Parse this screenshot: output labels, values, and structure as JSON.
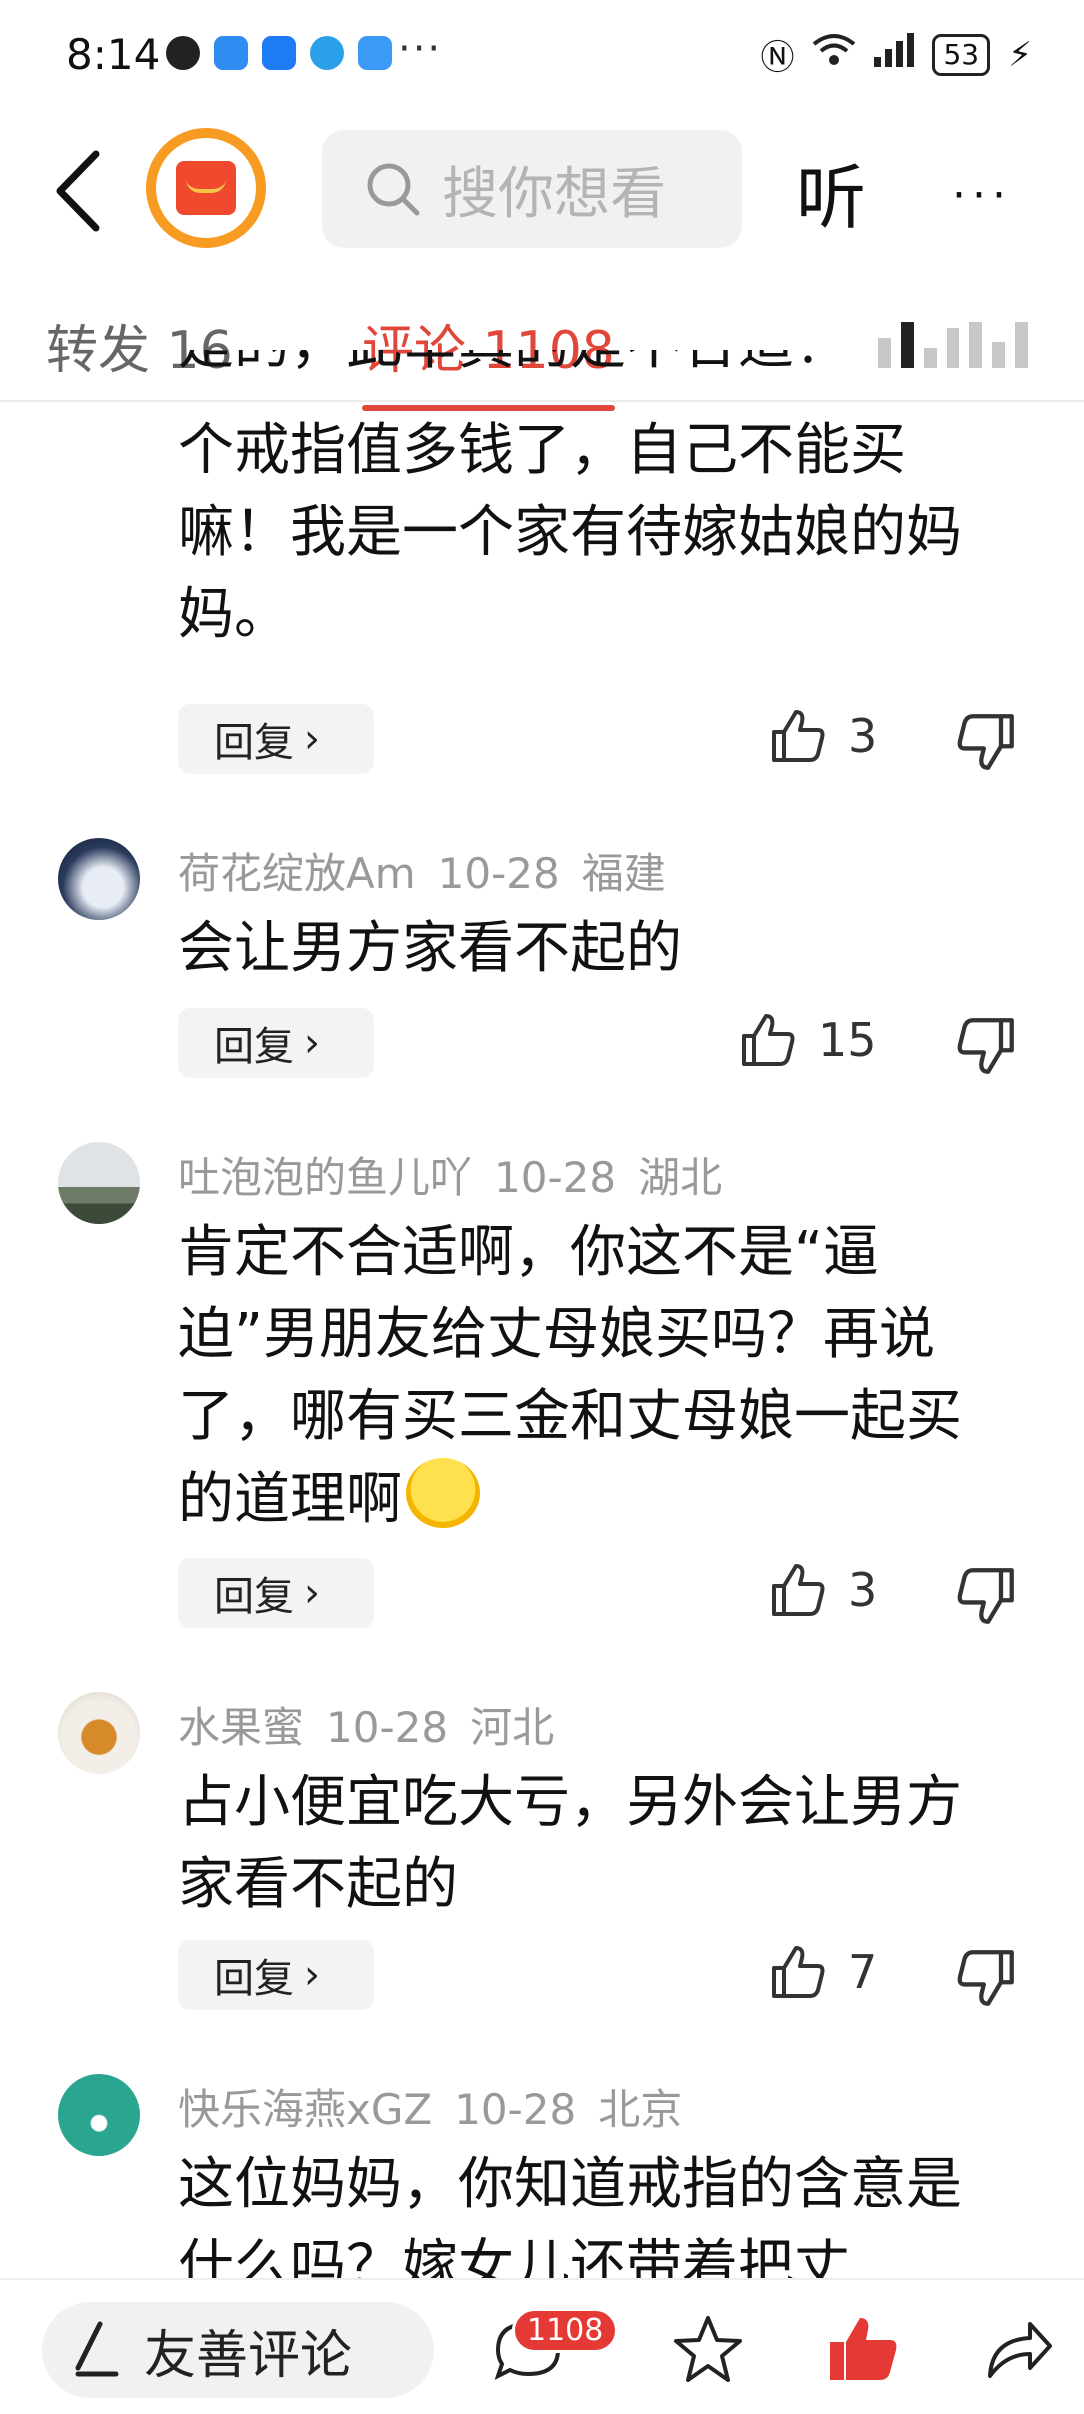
{
  "status_bar": {
    "time": "8:14",
    "more": "···",
    "battery": "53"
  },
  "search": {
    "placeholder": "搜你想看"
  },
  "header": {
    "listen": "听",
    "more": "···"
  },
  "tabs": [
    {
      "label": "转发 16",
      "active": false
    },
    {
      "label": "评论 1108",
      "active": true
    }
  ],
  "comments": [
    {
      "partial_first_line": "是的，此举真的是不合适！一",
      "text": "个戒指值多钱了，自己不能买嘛！我是一个家有待嫁姑娘的妈妈。",
      "reply": "回复",
      "likes": "3"
    },
    {
      "user": "荷花绽放Am",
      "date": "10-28",
      "location": "福建",
      "text": "会让男方家看不起的",
      "reply": "回复",
      "likes": "15"
    },
    {
      "user": "吐泡泡的鱼儿吖",
      "date": "10-28",
      "location": "湖北",
      "text": "肯定不合适啊，你这不是“逼迫”男朋友给丈母娘买吗？再说了，哪有买三金和丈母娘一起买的道理啊",
      "reply": "回复",
      "likes": "3"
    },
    {
      "user": "水果蜜",
      "date": "10-28",
      "location": "河北",
      "text": "占小便宜吃大亏，另外会让男方家看不起的",
      "reply": "回复",
      "likes": "7"
    },
    {
      "user": "快乐海燕xGZ",
      "date": "10-28",
      "location": "北京",
      "text": "这位妈妈，你知道戒指的含意是什么吗？嫁女儿还带着把丈"
    }
  ],
  "bottom_bar": {
    "comment_input": "友善评论",
    "comment_count_badge": "1108"
  },
  "colors": {
    "accent": "#e0463a",
    "like_active": "#e53935"
  }
}
